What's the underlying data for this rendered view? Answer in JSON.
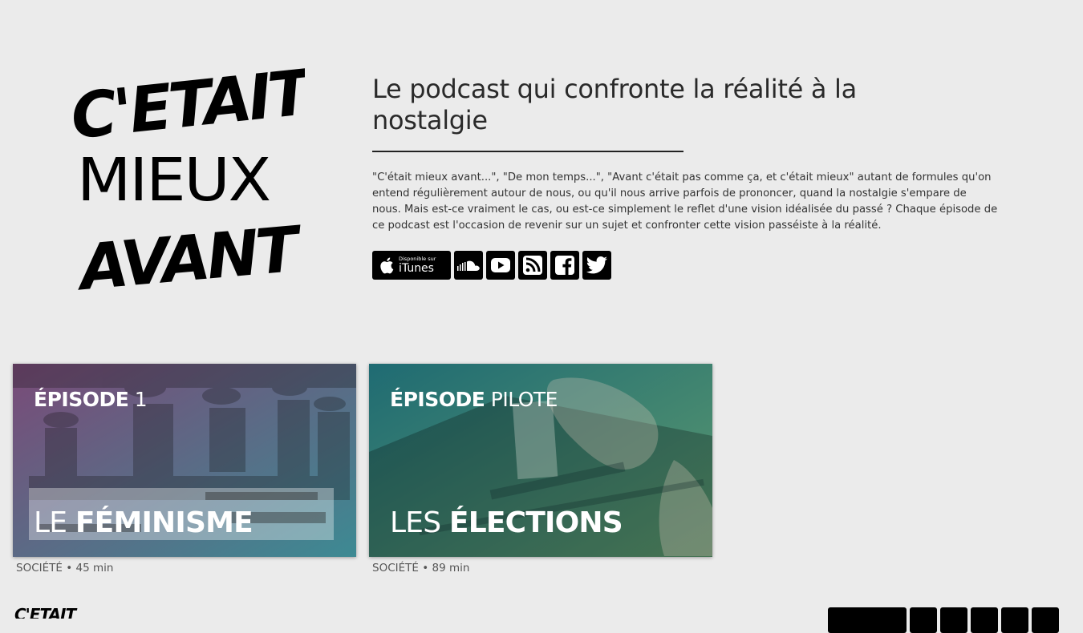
{
  "logo": {
    "line1": "C'ETAIT",
    "line2": "MIEUX",
    "line3": "AVANT"
  },
  "header": {
    "tagline": "Le podcast qui confronte la réalité à la nostalgie",
    "description": "\"C'était mieux avant...\", \"De mon temps...\", \"Avant c'était pas comme ça, et c'était mieux\" autant de formules qu'on entend régulièrement autour de nous, ou qu'il nous arrive parfois de prononcer, quand la nostalgie s'empare de nous. Mais est-ce vraiment le cas, ou est-ce simplement le reflet d'une vision idéalisée du passé ? Chaque épisode de ce podcast est l'occasion de revenir sur un sujet et confronter cette vision passéiste à la réalité."
  },
  "social": {
    "itunes_small": "Disponible sur",
    "itunes_big": "iTunes",
    "icons": [
      "apple-icon",
      "soundcloud-icon",
      "youtube-icon",
      "rss-icon",
      "facebook-icon",
      "twitter-icon"
    ]
  },
  "episodes": [
    {
      "ep_label": "ÉPISODE",
      "ep_num": "1",
      "title_article": "LE",
      "title_main": "FÉMINISME",
      "category": "SOCIÉTÉ",
      "duration": "45 min",
      "gradient": [
        "#7a4a78",
        "#3d8a93"
      ]
    },
    {
      "ep_label": "ÉPISODE",
      "ep_num": "PILOTE",
      "title_article": "LES",
      "title_main": "ÉLECTIONS",
      "category": "SOCIÉTÉ",
      "duration": "89 min",
      "gradient": [
        "#1f6b73",
        "#5d9a6e"
      ]
    }
  ],
  "meta_sep": "•"
}
